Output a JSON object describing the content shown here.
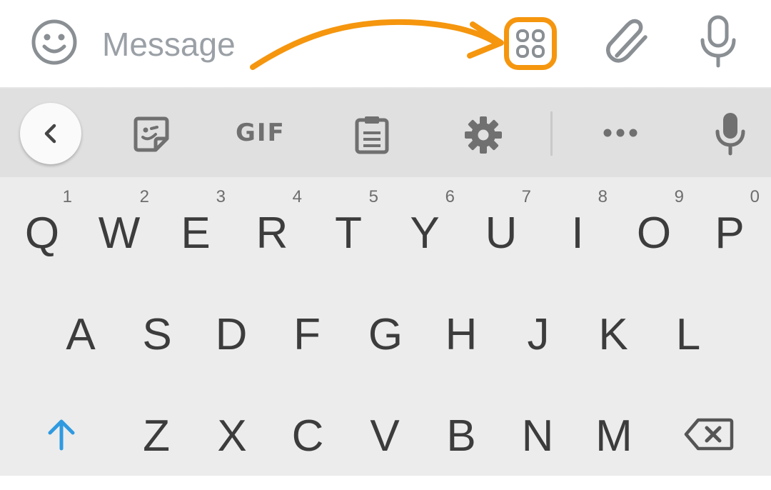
{
  "message_bar": {
    "placeholder": "Message",
    "accent_color": "#f5960e",
    "icons": [
      "smiley-icon",
      "apps-grid-icon",
      "paperclip-icon",
      "microphone-icon"
    ]
  },
  "toolbar": {
    "gif_label": "GIF",
    "icons": [
      "back-chevron-icon",
      "sticker-icon",
      "clipboard-icon",
      "gear-icon",
      "more-dots-icon",
      "microphone-icon"
    ]
  },
  "keyboard": {
    "row1": [
      {
        "letter": "Q",
        "hint": "1"
      },
      {
        "letter": "W",
        "hint": "2"
      },
      {
        "letter": "E",
        "hint": "3"
      },
      {
        "letter": "R",
        "hint": "4"
      },
      {
        "letter": "T",
        "hint": "5"
      },
      {
        "letter": "Y",
        "hint": "6"
      },
      {
        "letter": "U",
        "hint": "7"
      },
      {
        "letter": "I",
        "hint": "8"
      },
      {
        "letter": "O",
        "hint": "9"
      },
      {
        "letter": "P",
        "hint": "0"
      }
    ],
    "row2": [
      "A",
      "S",
      "D",
      "F",
      "G",
      "H",
      "J",
      "K",
      "L"
    ],
    "row3": [
      "Z",
      "X",
      "C",
      "V",
      "B",
      "N",
      "M"
    ],
    "shift_color": "#2f9ae0"
  }
}
